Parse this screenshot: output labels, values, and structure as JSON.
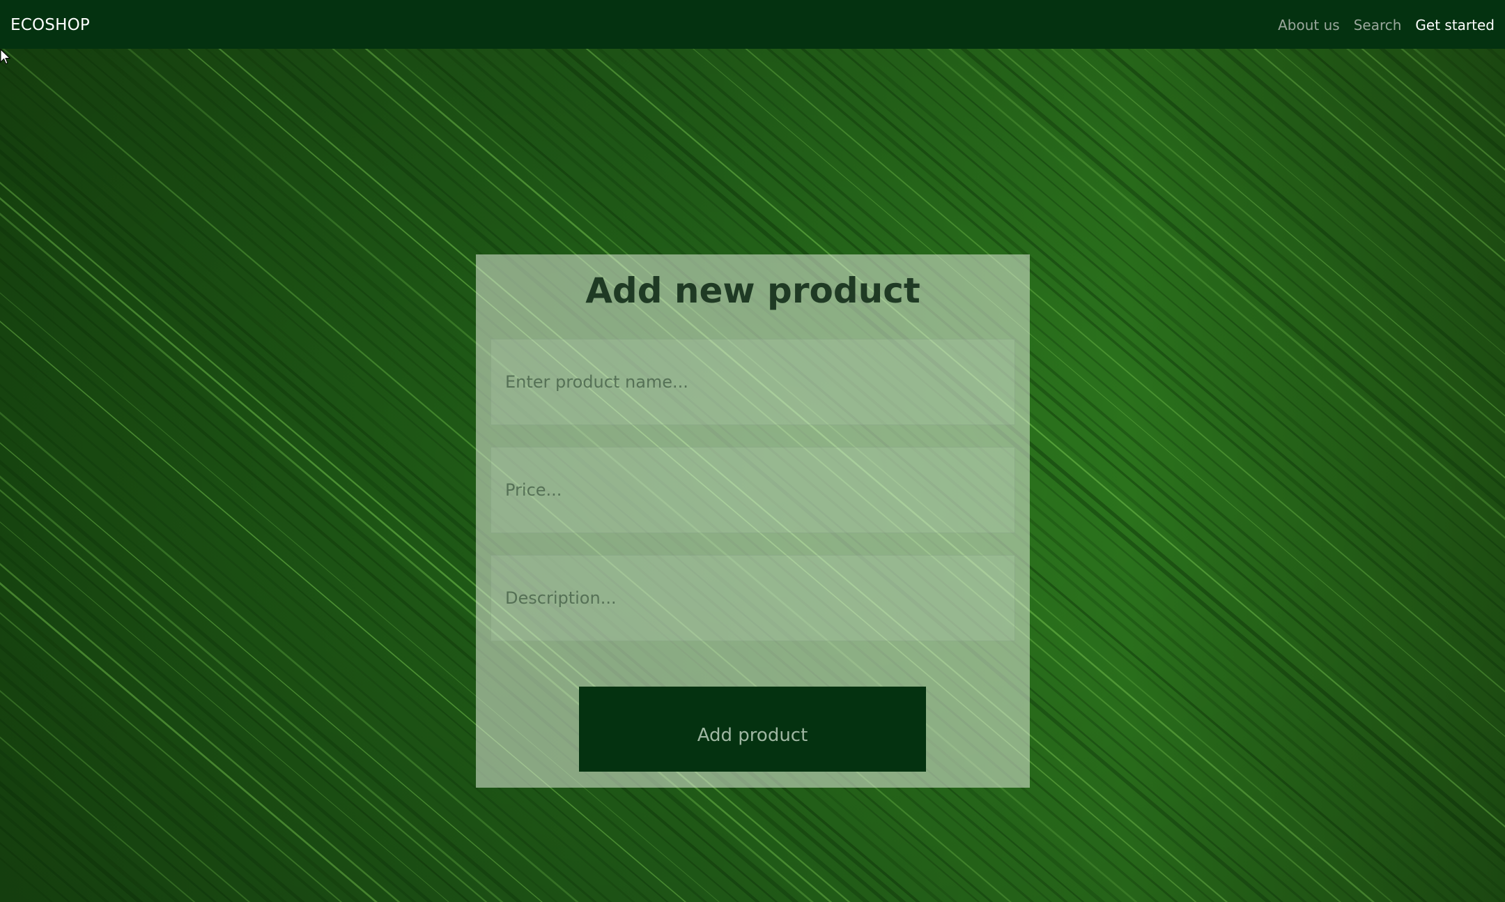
{
  "navbar": {
    "brand": "ECOSHOP",
    "links": [
      {
        "label": "About us"
      },
      {
        "label": "Search"
      },
      {
        "label": "Get started"
      }
    ]
  },
  "form": {
    "title": "Add new product",
    "name_placeholder": "Enter product name...",
    "price_placeholder": "Price...",
    "description_placeholder": "Description...",
    "submit_label": "Add product"
  },
  "colors": {
    "navbar_bg": "#043210",
    "button_bg": "#043210",
    "leaf_green": "#2e7a1c",
    "card_overlay": "rgba(225,235,220,0.55)"
  }
}
